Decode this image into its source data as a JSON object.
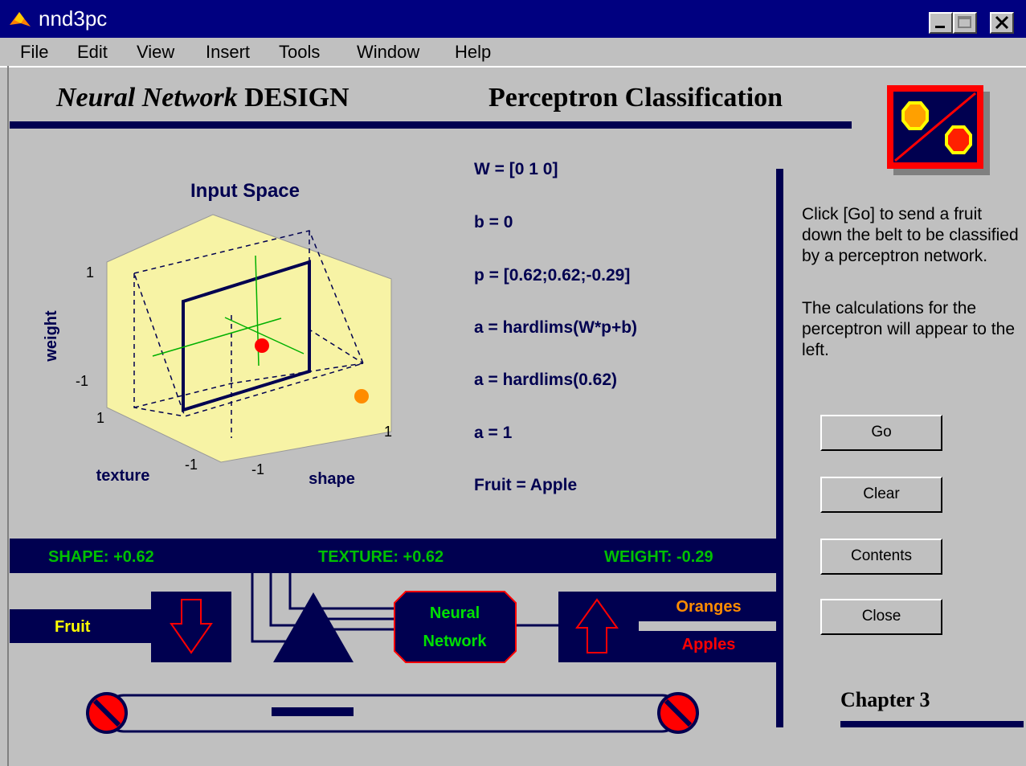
{
  "window": {
    "title": "nnd3pc"
  },
  "menu": [
    "File",
    "Edit",
    "View",
    "Insert",
    "Tools",
    "Window",
    "Help"
  ],
  "header": {
    "brand_italic": "Neural Network",
    "brand_plain": "DESIGN",
    "demo_title": "Perceptron Classification"
  },
  "plot": {
    "title": "Input Space",
    "xlabel": "texture",
    "ylabel": "shape",
    "zlabel": "weight",
    "ticks": {
      "z_top": "1",
      "z_bottom": "-1",
      "tex_near": "1",
      "tex_far": "-1",
      "shape_near": "-1",
      "shape_far": "1"
    }
  },
  "calc": {
    "w": "W = [0 1 0]",
    "b": "b = 0",
    "p": "p = [0.62;0.62;-0.29]",
    "a1": "a = hardlims(W*p+b)",
    "a2": "a = hardlims(0.62)",
    "a3": "a = 1",
    "fruit": "Fruit = Apple"
  },
  "instructions": {
    "p1": "Click [Go] to send a fruit down the belt to be classified by a perceptron network.",
    "p2": "The calculations for the perceptron will appear to the left."
  },
  "buttons": {
    "go": "Go",
    "clear": "Clear",
    "contents": "Contents",
    "close": "Close"
  },
  "sensors": {
    "shape": "SHAPE: +0.62",
    "texture": "TEXTURE: +0.62",
    "weight": "WEIGHT: -0.29"
  },
  "diagram": {
    "fruit": "Fruit",
    "nn_line1": "Neural",
    "nn_line2": "Network",
    "oranges": "Oranges",
    "apples": "Apples"
  },
  "footer": {
    "chapter": "Chapter 3"
  },
  "colors": {
    "navy": "#000050",
    "panel_yellow": "#f7f3a5",
    "sensor_green": "#00c000",
    "oranges": "#ff8c00",
    "apples": "#ff0000"
  }
}
